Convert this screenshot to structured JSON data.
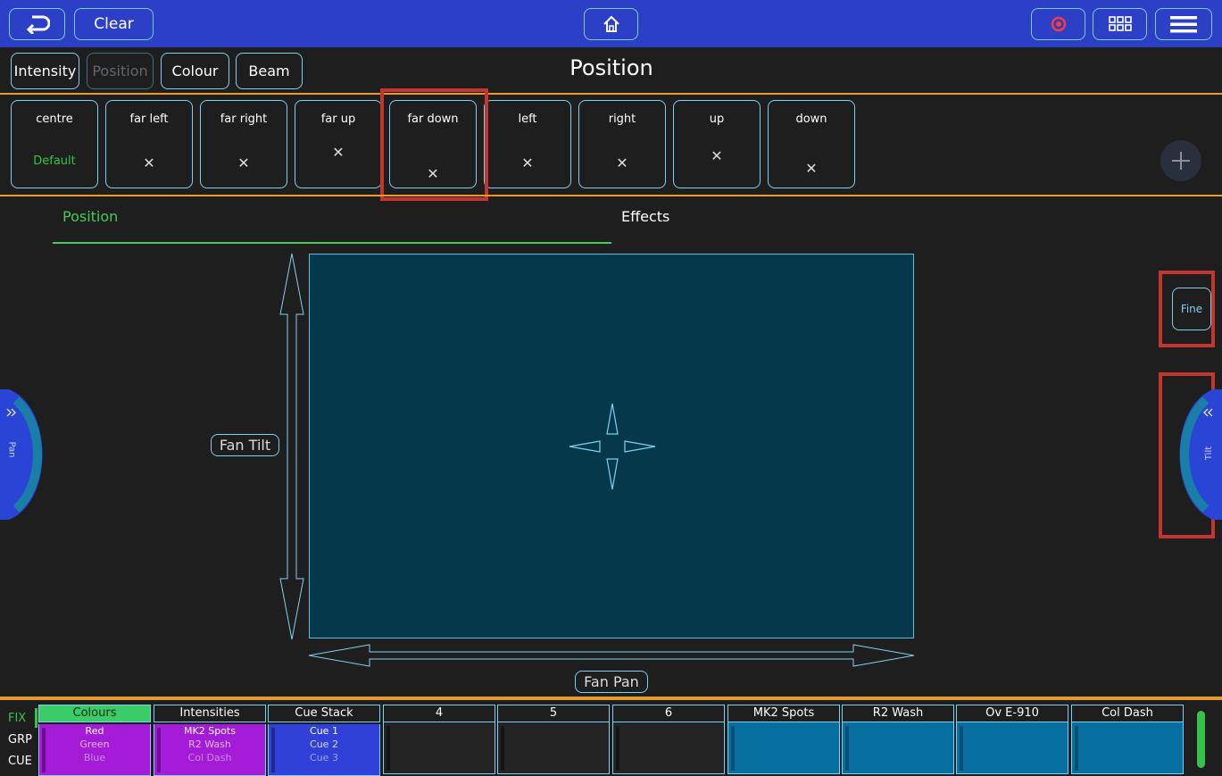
{
  "topbar": {
    "clear_label": "Clear"
  },
  "attr_tabs": [
    {
      "label": "Intensity"
    },
    {
      "label": "Position"
    },
    {
      "label": "Colour"
    },
    {
      "label": "Beam"
    }
  ],
  "page_title": "Position",
  "palettes": [
    {
      "label": "centre",
      "sub": "Default"
    },
    {
      "label": "far left",
      "x": "✕"
    },
    {
      "label": "far right",
      "x": "✕"
    },
    {
      "label": "far up",
      "x": "✕"
    },
    {
      "label": "far down",
      "x": "✕"
    },
    {
      "label": "left",
      "x": "✕"
    },
    {
      "label": "right",
      "x": "✕"
    },
    {
      "label": "up",
      "x": "✕"
    },
    {
      "label": "down",
      "x": "✕"
    }
  ],
  "view_tabs": {
    "position": "Position",
    "effects": "Effects"
  },
  "pad": {
    "fan_tilt": "Fan Tilt",
    "fan_pan": "Fan Pan"
  },
  "fine_label": "Fine",
  "wheels": {
    "left": "Pan",
    "right": "Tilt"
  },
  "bottom": {
    "side_labels": [
      "FIX",
      "GRP",
      "CUE"
    ],
    "columns": [
      {
        "header": "Colours",
        "lines": [
          "Red",
          "Green",
          "Blue"
        ]
      },
      {
        "header": "Intensities",
        "lines": [
          "MK2 Spots",
          "R2 Wash",
          "Col Dash"
        ]
      },
      {
        "header": "Cue Stack",
        "lines": [
          "Cue 1",
          "Cue 2",
          "Cue 3"
        ]
      },
      {
        "header": "4",
        "lines": []
      },
      {
        "header": "5",
        "lines": []
      },
      {
        "header": "6",
        "lines": []
      },
      {
        "header": "MK2 Spots",
        "lines": []
      },
      {
        "header": "R2 Wash",
        "lines": []
      },
      {
        "header": "Ov E-910",
        "lines": []
      },
      {
        "header": "Col Dash",
        "lines": []
      }
    ]
  },
  "colors": {
    "topbar": "#2b3fc7",
    "accent_orange": "#e89a2e",
    "accent_green": "#45c957",
    "pad": "#06384b",
    "highlight_red": "#c53530"
  }
}
